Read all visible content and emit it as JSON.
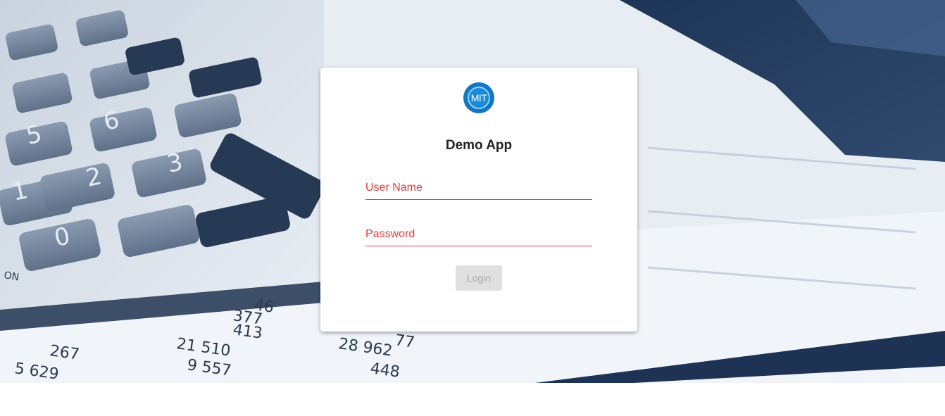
{
  "app": {
    "logo_text": "MIT",
    "title": "Demo App"
  },
  "form": {
    "username_placeholder": "User Name",
    "password_placeholder": "Password",
    "login_label": "Login"
  },
  "background": {
    "digits": [
      "267",
      "5 629",
      "21 510",
      "9 557",
      "413",
      "377",
      "46",
      "28 962",
      "77",
      "448",
      "ON"
    ],
    "keys": [
      "1",
      "2",
      "3",
      "5",
      "6",
      "0"
    ]
  },
  "colors": {
    "accent_error": "#e53935",
    "logo_blue": "#1275c6",
    "button_disabled_bg": "#e0e0e0",
    "button_disabled_text": "#a6a6a6"
  }
}
